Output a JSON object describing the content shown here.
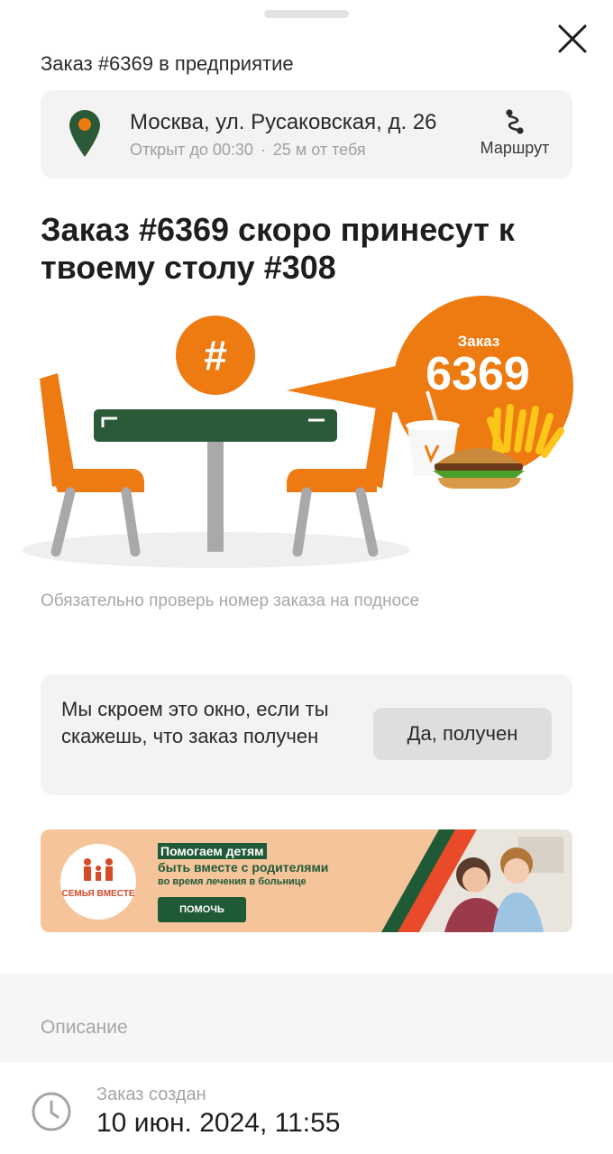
{
  "header": {
    "title": "Заказ #6369 в предприятие"
  },
  "location": {
    "address": "Москва, ул. Русаковская, д. 26",
    "hours": "Открыт до 00:30",
    "distance": "25 м от тебя",
    "route_label": "Маршрут"
  },
  "status": {
    "headline": "Заказ #6369 скоро принесут к твоему столу #308",
    "illustration": {
      "bubble_label": "Заказ",
      "order_number": "6369",
      "hash_symbol": "#"
    },
    "hint": "Обязательно проверь номер заказа на подносе"
  },
  "confirm": {
    "text": "Мы скроем это окно, если ты скажешь, что заказ получен",
    "button_label": "Да, получен"
  },
  "banner": {
    "logo_text": "СЕМЬЯ ВМЕСТЕ",
    "line1": "Помогаем детям",
    "line2": "быть вместе с родителями",
    "line3": "во время лечения в больнице",
    "button_label": "ПОМОЧЬ"
  },
  "description": {
    "section_label": "Описание",
    "created_label": "Заказ создан",
    "created_value": "10 июн. 2024, 11:55"
  },
  "colors": {
    "accent_orange": "#ee7a12",
    "brand_green": "#2a5a38",
    "card_bg": "#f3f3f3"
  },
  "icons": [
    "close-icon",
    "location-pin-icon",
    "route-icon",
    "clock-icon"
  ]
}
